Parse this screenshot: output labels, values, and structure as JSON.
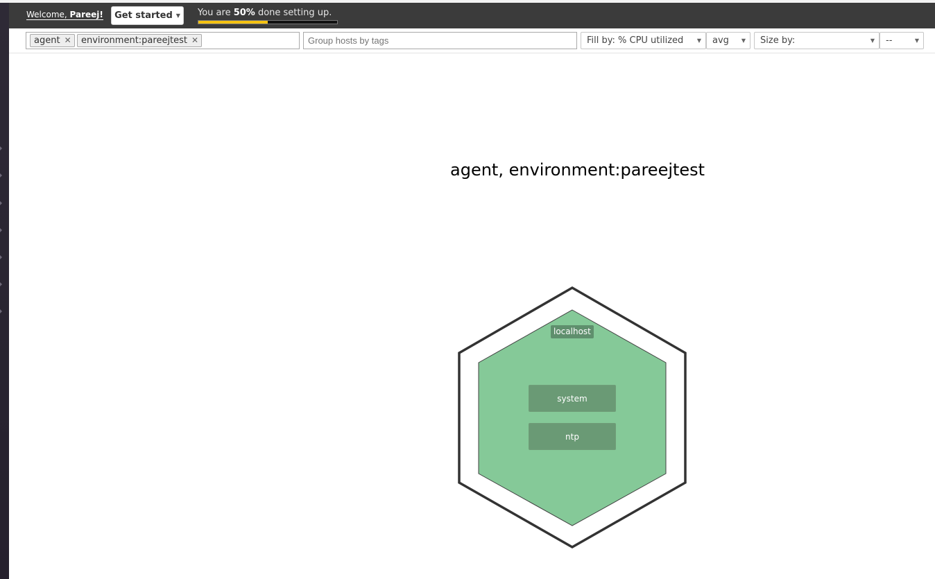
{
  "topbar": {
    "welcome_prefix": "Welcome, ",
    "user_name": "Pareej!",
    "get_started_label": "Get started",
    "progress_prefix": "You are ",
    "progress_percent_label": "50%",
    "progress_suffix": " done setting up.",
    "progress_fraction": 0.5,
    "progress_color": "#f5c211"
  },
  "filters": {
    "tags": [
      "agent",
      "environment:pareejtest"
    ],
    "group_placeholder": "Group hosts by tags",
    "fill_by_label": "Fill by: % CPU utilized",
    "fill_agg_label": "avg",
    "size_by_label": "Size by:",
    "size_agg_label": "--"
  },
  "map": {
    "group_title": "agent, environment:pareejtest",
    "host_label": "localhost",
    "host_fill_color": "#85c998",
    "apps": [
      "system",
      "ntp"
    ]
  }
}
